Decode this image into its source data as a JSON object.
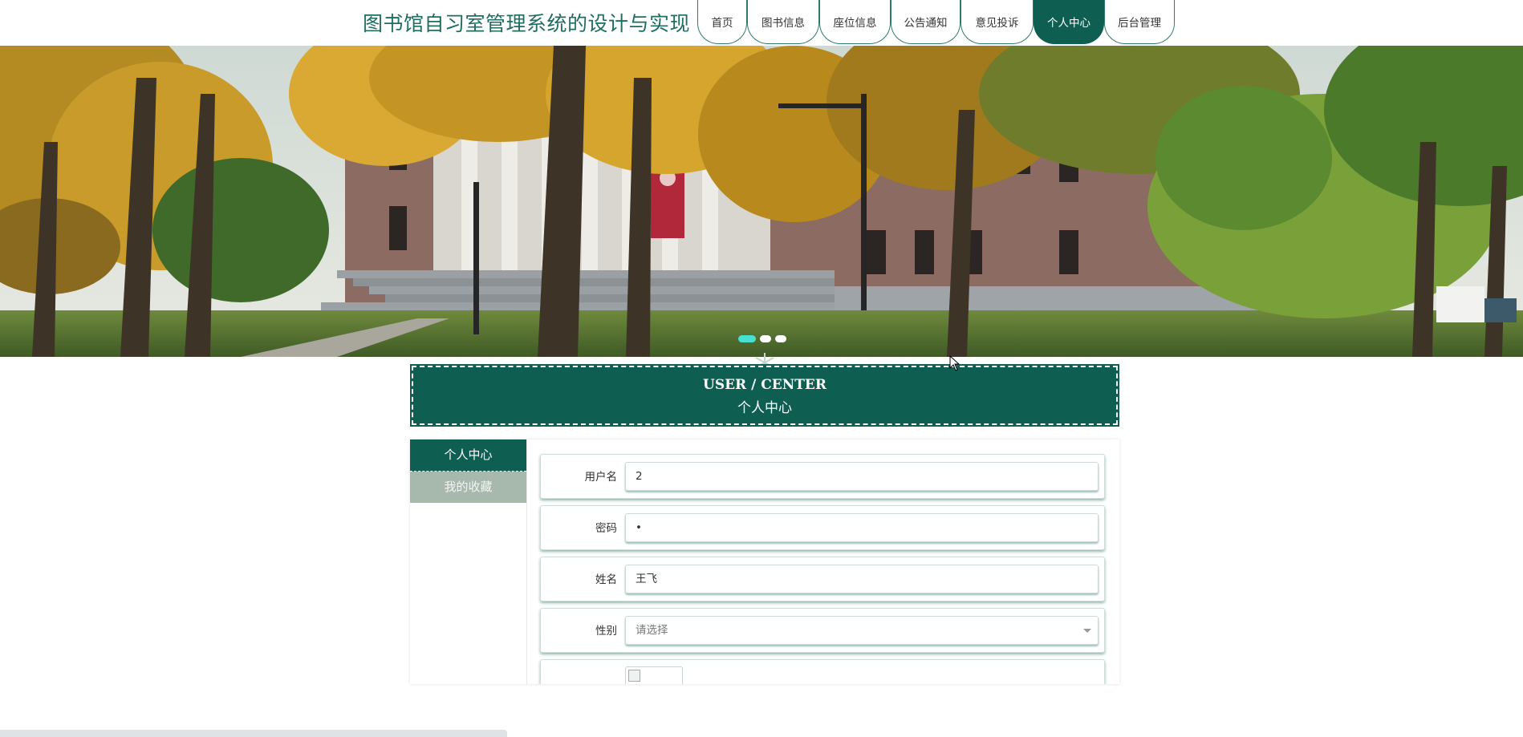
{
  "header": {
    "title": "图书馆自习室管理系统的设计与实现",
    "nav": [
      {
        "label": "首页",
        "active": false
      },
      {
        "label": "图书信息",
        "active": false
      },
      {
        "label": "座位信息",
        "active": false
      },
      {
        "label": "公告通知",
        "active": false
      },
      {
        "label": "意见投诉",
        "active": false
      },
      {
        "label": "个人中心",
        "active": true
      },
      {
        "label": "后台管理",
        "active": false
      }
    ]
  },
  "banner": {
    "slide_count": 3,
    "active_slide": 1
  },
  "section": {
    "title_en": "USER / CENTER",
    "title_zh": "个人中心"
  },
  "sidebar": {
    "items": [
      {
        "label": "个人中心",
        "active": true
      },
      {
        "label": "我的收藏",
        "active": false
      }
    ]
  },
  "form": {
    "username": {
      "label": "用户名",
      "value": "2"
    },
    "password": {
      "label": "密码",
      "value": "•"
    },
    "name": {
      "label": "姓名",
      "value": "王飞"
    },
    "gender": {
      "label": "性别",
      "value": "请选择"
    },
    "avatar": {
      "label": ""
    }
  },
  "colors": {
    "primary": "#0f5e52",
    "title_text": "#1e6e62",
    "sidebar_inactive": "#a7b8ad",
    "active_dot": "#49e0cf"
  }
}
